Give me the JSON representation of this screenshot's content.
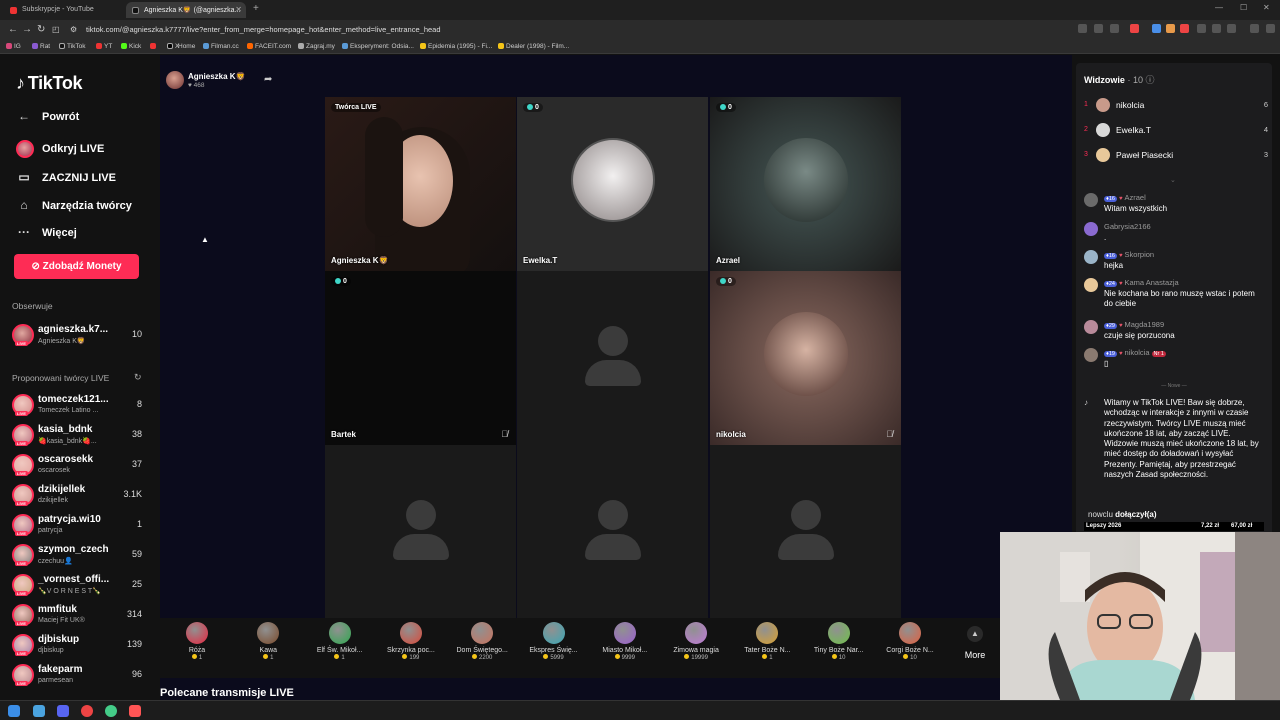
{
  "browser": {
    "tabs": [
      {
        "label": "Subskrypcje - YouTube",
        "active": false
      },
      {
        "label": "Agnieszka K🦁 (@agnieszka...",
        "active": true
      }
    ],
    "url": "tiktok.com/@agnieszka.k7777/live?enter_from_merge=homepage_hot&enter_method=live_entrance_head",
    "bookmarks": [
      "IG",
      "Rat",
      "TikTok",
      "YT",
      "Kick",
      "X",
      "Home",
      "Filman.cc",
      "FACEIT.com",
      "Zagraj.my",
      "Eksperyment: Odsia...",
      "Epidemia (1995) - Fi...",
      "Dealer (1998) - Film..."
    ]
  },
  "sidebar": {
    "logo": "TikTok",
    "nav": [
      {
        "icon": "arrow-left-icon",
        "label": "Powrót"
      },
      {
        "icon": "avatar",
        "label": "Odkryj LIVE"
      },
      {
        "icon": "video-camera-icon",
        "label": "ZACZNIJ LIVE"
      },
      {
        "icon": "home-icon",
        "label": "Narzędzia twórcy"
      },
      {
        "icon": "more-dots-icon",
        "label": "Więcej"
      }
    ],
    "coins_button": "Zdobądź Monety",
    "following_title": "Obserwuje",
    "following": [
      {
        "name": "agnieszka.k7...",
        "sub": "Agnieszka K🦁",
        "count": "10"
      }
    ],
    "suggested_title": "Proponowani twórcy LIVE",
    "live_badge": "LIVE",
    "suggested": [
      {
        "name": "tomeczek121...",
        "sub": "Tomeczek Latino ...",
        "count": "8"
      },
      {
        "name": "kasia_bdnk",
        "sub": "🍓kasia_bdnk🍓...",
        "count": "38"
      },
      {
        "name": "oscarosekk",
        "sub": "oscarosek",
        "count": "37"
      },
      {
        "name": "dzikijellek",
        "sub": "dzikijellek",
        "count": "3.1K"
      },
      {
        "name": "patrycja.wi10",
        "sub": "patrycja",
        "count": "1"
      },
      {
        "name": "szymon_czech",
        "sub": "czechuu👤",
        "count": "59"
      },
      {
        "name": "_vornest_offi...",
        "sub": "🍾V O R N E S T🍾",
        "count": "25"
      },
      {
        "name": "mmfituk",
        "sub": "Maciej Fit UK®",
        "count": "314"
      },
      {
        "name": "djbiskup",
        "sub": "djbiskup",
        "count": "139"
      },
      {
        "name": "fakeparm",
        "sub": "parmesean",
        "count": "96"
      }
    ]
  },
  "stage": {
    "host_name": "Agnieszka K🦁",
    "host_likes": "468",
    "grid": [
      {
        "label": "Agnieszka K🦁",
        "badge": "Twórca LIVE",
        "score": null,
        "type": "video-woman"
      },
      {
        "label": "Ewelka.T",
        "badge": null,
        "score": "0",
        "type": "anime"
      },
      {
        "label": "Azrael",
        "badge": null,
        "score": "0",
        "type": "dark-figure"
      },
      {
        "label": "Bartek",
        "badge": null,
        "score": "0",
        "type": "black",
        "muted": true
      },
      {
        "label": "",
        "badge": null,
        "score": null,
        "type": "empty"
      },
      {
        "label": "nikolcia",
        "badge": null,
        "score": "0",
        "type": "portrait",
        "muted": true
      },
      {
        "label": "",
        "badge": null,
        "score": null,
        "type": "empty"
      },
      {
        "label": "",
        "badge": null,
        "score": null,
        "type": "empty"
      },
      {
        "label": "",
        "badge": null,
        "score": null,
        "type": "empty"
      }
    ]
  },
  "gifts": [
    {
      "name": "Róża",
      "price": "1",
      "color": "#e8253f"
    },
    {
      "name": "Kawa",
      "price": "1",
      "color": "#7a4a2a"
    },
    {
      "name": "Elf Św. Mikoł...",
      "price": "1",
      "color": "#2fa84f"
    },
    {
      "name": "Skrzynka poc...",
      "price": "199",
      "color": "#d94a3a"
    },
    {
      "name": "Dom Świętego...",
      "price": "2200",
      "color": "#c9735e"
    },
    {
      "name": "Ekspres Świę...",
      "price": "5999",
      "color": "#3aa7b5"
    },
    {
      "name": "Miasto Mikoł...",
      "price": "9999",
      "color": "#9b5fd0"
    },
    {
      "name": "Zimowa magia",
      "price": "19999",
      "color": "#c07ad8"
    },
    {
      "name": "Tater Boże N...",
      "price": "1",
      "color": "#d8a030"
    },
    {
      "name": "Tiny Boże Nar...",
      "price": "10",
      "color": "#6fc04a"
    },
    {
      "name": "Corgi Boże N...",
      "price": "10",
      "color": "#e06040"
    }
  ],
  "more_label": "More",
  "recommended_title": "Polecane transmisje LIVE",
  "viewers": {
    "title": "Widzowie",
    "count": "10",
    "top": [
      {
        "rank": "1",
        "name": "nikolcia",
        "value": "6"
      },
      {
        "rank": "2",
        "name": "Ewelka.T",
        "value": "4"
      },
      {
        "rank": "3",
        "name": "Paweł Piasecki",
        "value": "3"
      }
    ]
  },
  "chat": {
    "messages": [
      {
        "level": "16",
        "user": "Azrael",
        "text": "Witam wszystkich",
        "nr": null
      },
      {
        "level": null,
        "user": "Gabrysia2166",
        "text": ".",
        "nr": null
      },
      {
        "level": "16",
        "user": "Skorpion",
        "text": "hejka",
        "nr": null
      },
      {
        "level": "24",
        "user": "Kama Anastazja",
        "text": "Nie kochana bo rano muszę wstac i potem do ciebie",
        "nr": null
      },
      {
        "level": "29",
        "user": "Magda1989",
        "text": "czuje się porzucona",
        "nr": null
      },
      {
        "level": "19",
        "user": "nikolcia",
        "text": "▯",
        "nr": "Nr 1"
      }
    ],
    "separator": "Nowe",
    "system_message": "Witamy w TikTok LIVE! Baw się dobrze, wchodząc w interakcje z innymi w czasie rzeczywistym. Twórcy LIVE muszą mieć ukończone 18 lat, aby zacząć LIVE. Widzowie muszą mieć ukończone 18 lat, by mieć dostęp do doładowań i wysyłać Prezenty. Pamiętaj, aby przestrzegać naszych Zasad społeczności.",
    "joined_user": "nowclu",
    "joined_text": "dołączył(a)",
    "ticker": [
      "Lepszy 2026",
      "7,22 zł",
      "67,00 zł"
    ]
  }
}
